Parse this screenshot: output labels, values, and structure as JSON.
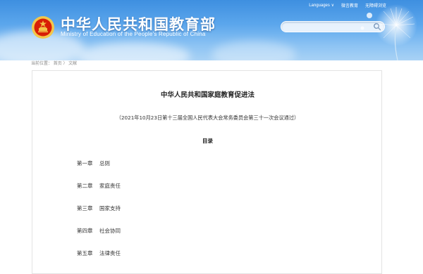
{
  "header": {
    "title": "中华人民共和国教育部",
    "subtitle": "Ministry of Education of the People's Republic of China",
    "top_links": {
      "languages": "Languages ∨",
      "mobile_edu": "微言教育",
      "accessibility": "无障碍浏览"
    },
    "search": {
      "placeholder": ""
    }
  },
  "breadcrumb": {
    "prefix": "当前位置：",
    "home": "首页",
    "sep": "〉",
    "current": "文献"
  },
  "document": {
    "title": "中华人民共和国家庭教育促进法",
    "subtitle": "（2021年10月23日第十三届全国人民代表大会常务委员会第三十一次会议通过）",
    "toc_heading": "目录",
    "chapters": [
      {
        "number": "第一章",
        "name": "总则"
      },
      {
        "number": "第二章",
        "name": "家庭责任"
      },
      {
        "number": "第三章",
        "name": "国家支持"
      },
      {
        "number": "第四章",
        "name": "社会协同"
      },
      {
        "number": "第五章",
        "name": "法律责任"
      }
    ]
  },
  "colors": {
    "header_blue": "#3e8fe0",
    "emblem_red": "#d81e06",
    "emblem_gold": "#f3c74a"
  }
}
